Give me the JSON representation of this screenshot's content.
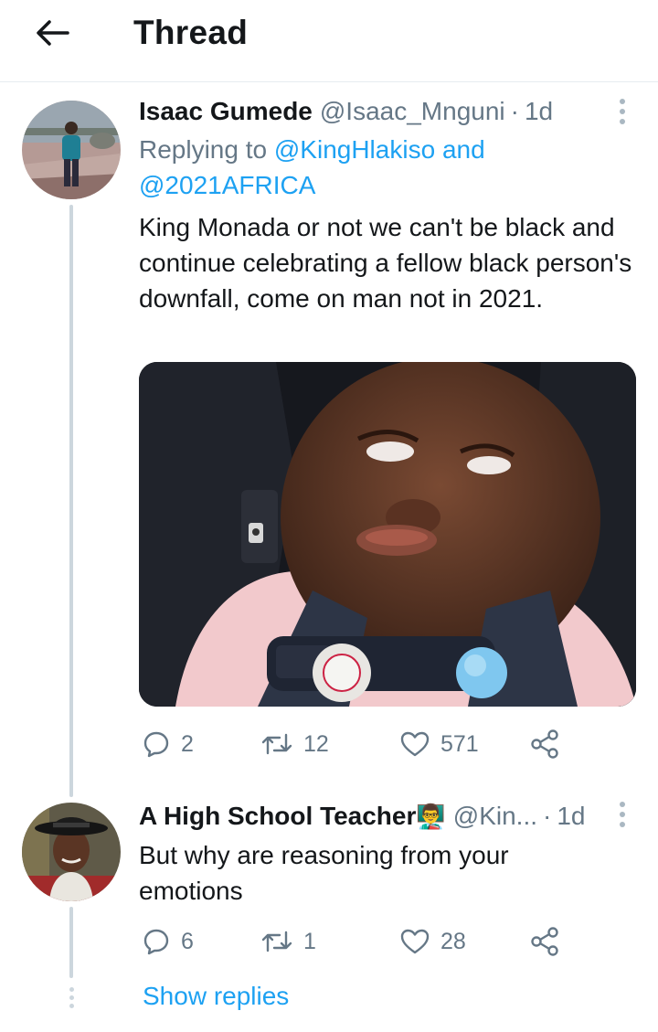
{
  "header": {
    "title": "Thread",
    "back_icon": "arrow-left-icon"
  },
  "tweet1": {
    "author_name": "Isaac Gumede",
    "handle": "@Isaac_Mnguni",
    "separator": "·",
    "time": "1d",
    "replying_prefix": "Replying to",
    "mention_1": "@KingHlakiso",
    "mention_joiner": "and",
    "mention_2": "@2021AFRICA",
    "text": "King Monada or not we can't be black and continue celebrating a fellow black person's downfall, come on man not in 2021.",
    "stats": {
      "replies": "2",
      "retweets": "12",
      "likes": "571"
    }
  },
  "tweet2": {
    "author_name": "A High School Teacher",
    "emoji": "👨‍🏫",
    "handle": "@Kin...",
    "separator": "·",
    "time": "1d",
    "text": "But why are reasoning from your emotions",
    "stats": {
      "replies": "6",
      "retweets": "1",
      "likes": "28"
    }
  },
  "show_replies_label": "Show replies",
  "colors": {
    "accent": "#1da1f2",
    "text": "#14171a",
    "muted": "#657786",
    "divider": "#e6ecf0",
    "thread_line": "#ccd6dd"
  }
}
